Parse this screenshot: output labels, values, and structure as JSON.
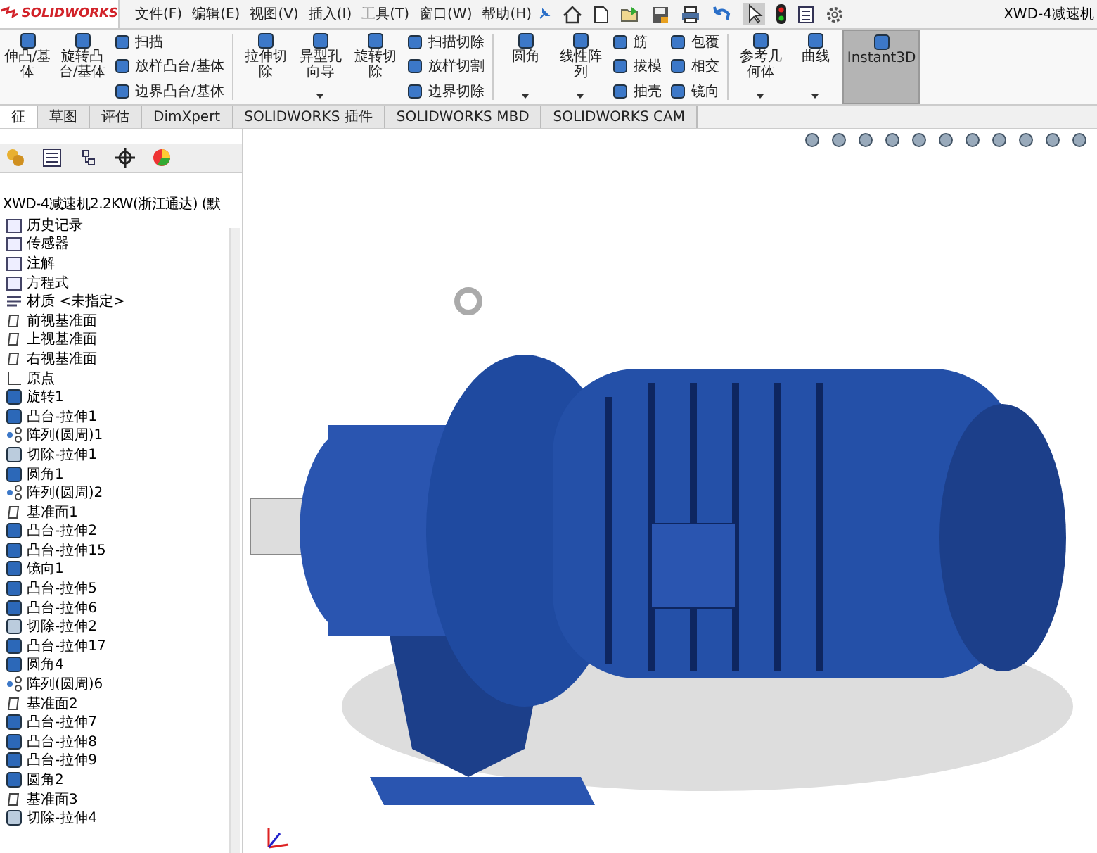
{
  "app": {
    "logo": "SOLIDWORKS",
    "title": "XWD-4减速机"
  },
  "menu": [
    "文件(F)",
    "编辑(E)",
    "视图(V)",
    "插入(I)",
    "工具(T)",
    "窗口(W)",
    "帮助(H)"
  ],
  "ribbon": [
    {
      "kind": "large",
      "label": "伸凸/基体",
      "dropdown": false,
      "selected": false
    },
    {
      "kind": "large",
      "label": "旋转凸台/基体",
      "dropdown": false,
      "selected": false
    },
    {
      "kind": "stack",
      "items": [
        {
          "label": "扫描"
        },
        {
          "label": "放样凸台/基体"
        },
        {
          "label": "边界凸台/基体"
        }
      ]
    },
    {
      "kind": "divider"
    },
    {
      "kind": "large",
      "label": "拉伸切除",
      "dropdown": false,
      "selected": false
    },
    {
      "kind": "large",
      "label": "异型孔向导",
      "dropdown": true,
      "selected": false
    },
    {
      "kind": "large",
      "label": "旋转切除",
      "dropdown": false,
      "selected": false
    },
    {
      "kind": "stack",
      "items": [
        {
          "label": "扫描切除"
        },
        {
          "label": "放样切割"
        },
        {
          "label": "边界切除"
        }
      ]
    },
    {
      "kind": "divider"
    },
    {
      "kind": "large",
      "label": "圆角",
      "dropdown": true,
      "selected": false
    },
    {
      "kind": "large",
      "label": "线性阵列",
      "dropdown": true,
      "selected": false
    },
    {
      "kind": "stack",
      "items": [
        {
          "label": "筋"
        },
        {
          "label": "拔模"
        },
        {
          "label": "抽壳"
        }
      ]
    },
    {
      "kind": "stack",
      "items": [
        {
          "label": "包覆"
        },
        {
          "label": "相交"
        },
        {
          "label": "镜向"
        }
      ]
    },
    {
      "kind": "divider"
    },
    {
      "kind": "large",
      "label": "参考几何体",
      "dropdown": true,
      "selected": false
    },
    {
      "kind": "large",
      "label": "曲线",
      "dropdown": true,
      "selected": false
    },
    {
      "kind": "large",
      "label": "Instant3D",
      "dropdown": false,
      "selected": true
    }
  ],
  "tabs": [
    {
      "label": "征",
      "selected": true
    },
    {
      "label": "草图",
      "selected": false
    },
    {
      "label": "评估",
      "selected": false
    },
    {
      "label": "DimXpert",
      "selected": false
    },
    {
      "label": "SOLIDWORKS 插件",
      "selected": false
    },
    {
      "label": "SOLIDWORKS MBD",
      "selected": false
    },
    {
      "label": "SOLIDWORKS CAM",
      "selected": false
    }
  ],
  "tree": {
    "root": "XWD-4减速机2.2KW(浙江通达) (默",
    "items": [
      {
        "label": "历史记录",
        "kind": "history"
      },
      {
        "label": "传感器",
        "kind": "sensor"
      },
      {
        "label": "注解",
        "kind": "annotation"
      },
      {
        "label": "方程式",
        "kind": "equation"
      },
      {
        "label": "材质 <未指定>",
        "kind": "material"
      },
      {
        "label": "前视基准面",
        "kind": "plane"
      },
      {
        "label": "上视基准面",
        "kind": "plane"
      },
      {
        "label": "右视基准面",
        "kind": "plane"
      },
      {
        "label": "原点",
        "kind": "origin"
      },
      {
        "label": "旋转1",
        "kind": "revolve"
      },
      {
        "label": "凸台-拉伸1",
        "kind": "boss"
      },
      {
        "label": "阵列(圆周)1",
        "kind": "pattern"
      },
      {
        "label": "切除-拉伸1",
        "kind": "cut"
      },
      {
        "label": "圆角1",
        "kind": "fillet"
      },
      {
        "label": "阵列(圆周)2",
        "kind": "pattern"
      },
      {
        "label": "基准面1",
        "kind": "plane"
      },
      {
        "label": "凸台-拉伸2",
        "kind": "boss"
      },
      {
        "label": "凸台-拉伸15",
        "kind": "boss"
      },
      {
        "label": "镜向1",
        "kind": "mirror"
      },
      {
        "label": "凸台-拉伸5",
        "kind": "boss"
      },
      {
        "label": "凸台-拉伸6",
        "kind": "boss"
      },
      {
        "label": "切除-拉伸2",
        "kind": "cut"
      },
      {
        "label": "凸台-拉伸17",
        "kind": "boss"
      },
      {
        "label": "圆角4",
        "kind": "fillet"
      },
      {
        "label": "阵列(圆周)6",
        "kind": "pattern"
      },
      {
        "label": "基准面2",
        "kind": "plane"
      },
      {
        "label": "凸台-拉伸7",
        "kind": "boss"
      },
      {
        "label": "凸台-拉伸8",
        "kind": "boss"
      },
      {
        "label": "凸台-拉伸9",
        "kind": "boss"
      },
      {
        "label": "圆角2",
        "kind": "fillet"
      },
      {
        "label": "基准面3",
        "kind": "plane"
      },
      {
        "label": "切除-拉伸4",
        "kind": "cut"
      }
    ]
  }
}
